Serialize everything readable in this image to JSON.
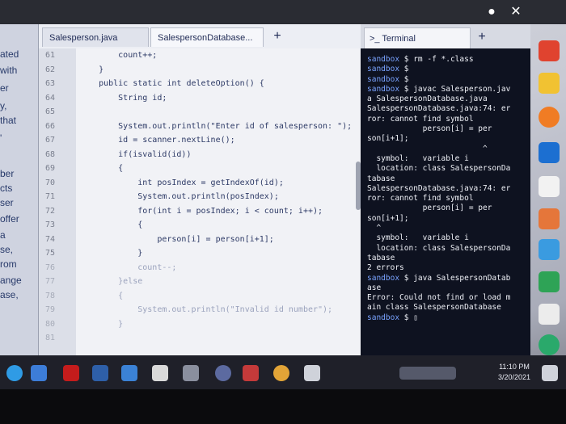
{
  "window_controls": {
    "minimize": "●",
    "close": "✕"
  },
  "left_panel": {
    "fragments": [
      "ated",
      "with",
      "er",
      "y,",
      "that",
      "'",
      "ber",
      "cts",
      "ser",
      "offer",
      "a",
      "se,",
      "rom",
      "ange",
      "ase,"
    ]
  },
  "editor": {
    "tabs": [
      {
        "label": "Salesperson.java"
      },
      {
        "label": "SalespersonDatabase..."
      }
    ],
    "new_tab": "+",
    "lines": [
      {
        "n": "61",
        "text": "        count++;",
        "faded": false
      },
      {
        "n": "62",
        "text": "    }",
        "faded": false
      },
      {
        "n": "63",
        "text": "    public static int deleteOption() {",
        "faded": false
      },
      {
        "n": "64",
        "text": "        String id;",
        "faded": false
      },
      {
        "n": "65",
        "text": "",
        "faded": false
      },
      {
        "n": "66",
        "text": "        System.out.println(\"Enter id of salesperson: \");",
        "faded": false
      },
      {
        "n": "67",
        "text": "        id = scanner.nextLine();",
        "faded": false
      },
      {
        "n": "68",
        "text": "        if(isvalid(id))",
        "faded": false
      },
      {
        "n": "69",
        "text": "        {",
        "faded": false
      },
      {
        "n": "70",
        "text": "            int posIndex = getIndexOf(id);",
        "faded": false
      },
      {
        "n": "71",
        "text": "            System.out.println(posIndex);",
        "faded": false
      },
      {
        "n": "72",
        "text": "            for(int i = posIndex; i < count; i++);",
        "faded": false
      },
      {
        "n": "73",
        "text": "            {",
        "faded": false
      },
      {
        "n": "74",
        "text": "                person[i] = person[i+1];",
        "faded": false
      },
      {
        "n": "75",
        "text": "            }",
        "faded": false
      },
      {
        "n": "76",
        "text": "            count--;",
        "faded": true
      },
      {
        "n": "77",
        "text": "        }else",
        "faded": true
      },
      {
        "n": "78",
        "text": "        {",
        "faded": true
      },
      {
        "n": "79",
        "text": "            System.out.println(\"Invalid id number\");",
        "faded": true
      },
      {
        "n": "80",
        "text": "        }",
        "faded": true
      },
      {
        "n": "81",
        "text": "",
        "faded": true
      }
    ]
  },
  "terminal": {
    "tab_label": ">_ Terminal",
    "new_tab": "+",
    "lines": [
      {
        "prompt": "sandbox",
        "text": " $ rm -f *.class"
      },
      {
        "prompt": "sandbox",
        "text": " $"
      },
      {
        "prompt": "sandbox",
        "text": " $"
      },
      {
        "prompt": "sandbox",
        "text": " $ javac Salesperson.jav"
      },
      {
        "prompt": "",
        "text": "a SalespersonDatabase.java"
      },
      {
        "prompt": "",
        "text": "SalespersonDatabase.java:74: er"
      },
      {
        "prompt": "",
        "text": "ror: cannot find symbol"
      },
      {
        "prompt": "",
        "text": "            person[i] = per"
      },
      {
        "prompt": "",
        "text": "son[i+1];"
      },
      {
        "prompt": "",
        "text": "                         ^"
      },
      {
        "prompt": "",
        "text": "  symbol:   variable i"
      },
      {
        "prompt": "",
        "text": "  location: class SalespersonDa"
      },
      {
        "prompt": "",
        "text": "tabase"
      },
      {
        "prompt": "",
        "text": "SalespersonDatabase.java:74: er"
      },
      {
        "prompt": "",
        "text": "ror: cannot find symbol"
      },
      {
        "prompt": "",
        "text": "            person[i] = per"
      },
      {
        "prompt": "",
        "text": "son[i+1];"
      },
      {
        "prompt": "",
        "text": ""
      },
      {
        "prompt": "",
        "text": "  ^"
      },
      {
        "prompt": "",
        "text": "  symbol:   variable i"
      },
      {
        "prompt": "",
        "text": "  location: class SalespersonDa"
      },
      {
        "prompt": "",
        "text": "tabase"
      },
      {
        "prompt": "",
        "text": "2 errors"
      },
      {
        "prompt": "sandbox",
        "text": " $ java SalespersonDatab"
      },
      {
        "prompt": "",
        "text": "ase"
      },
      {
        "prompt": "",
        "text": "Error: Could not find or load m"
      },
      {
        "prompt": "",
        "text": "ain class SalespersonDatabase"
      },
      {
        "prompt": "sandbox",
        "text": " $ ▯"
      }
    ]
  },
  "taskbar": {
    "time": "11:10 PM",
    "date": "3/20/2021"
  },
  "colors": {
    "terminal_bg": "#0e1220",
    "prompt": "#7aa3ff",
    "code_text": "#2d3a66",
    "taskbar_bg": "#1f2029"
  }
}
